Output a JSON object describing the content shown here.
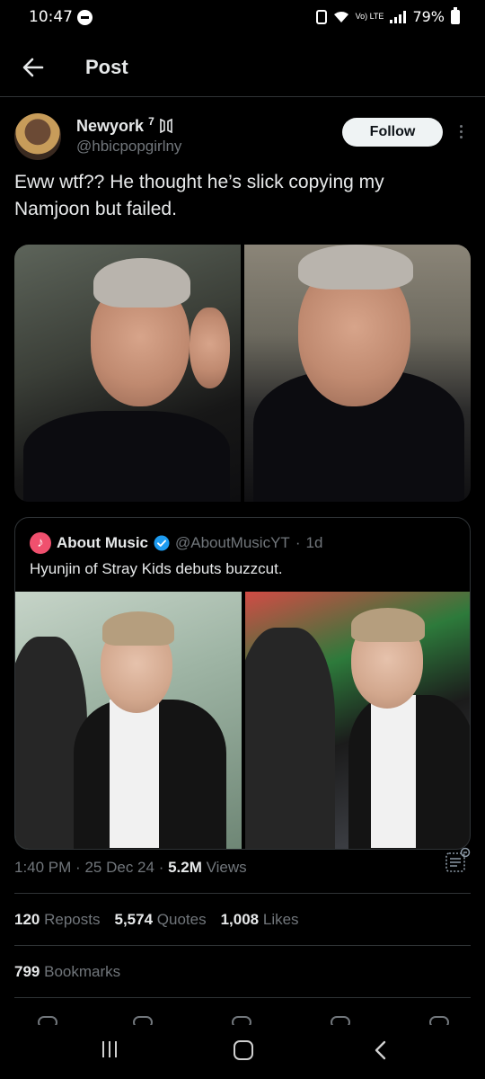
{
  "status_bar": {
    "time": "10:47",
    "lte_label": "Vo) LTE",
    "battery": "79%"
  },
  "header": {
    "title": "Post"
  },
  "author": {
    "name": "Newyork",
    "name_suffix": "7",
    "handle": "@hbicpopgirlny",
    "follow_label": "Follow"
  },
  "tweet": {
    "text": "Eww wtf?? He thought he’s slick copying my Namjoon but failed."
  },
  "quote": {
    "avatar_glyph": "♪",
    "name": "About Music",
    "handle": "@AboutMusicYT",
    "separator": "·",
    "age": "1d",
    "text": "Hyunjin of Stray Kids debuts buzzcut."
  },
  "meta": {
    "time": "1:40 PM",
    "separator": "·",
    "date": "25 Dec 24",
    "views_count": "5.2M",
    "views_label": "Views"
  },
  "stats": {
    "reposts_count": "120",
    "reposts_label": "Reposts",
    "quotes_count": "5,574",
    "quotes_label": "Quotes",
    "likes_count": "1,008",
    "likes_label": "Likes",
    "bookmarks_count": "799",
    "bookmarks_label": "Bookmarks"
  },
  "colors": {
    "background": "#000000",
    "text_primary": "#e7e9ea",
    "text_secondary": "#71767b",
    "border": "#2f3336",
    "verified": "#1d9bf0",
    "follow_bg": "#eff3f4"
  },
  "icons": {
    "back": "arrow-left-icon",
    "more": "more-vertical-icon",
    "verified": "verified-badge-icon",
    "analytics": "analytics-icon",
    "nav": [
      "recent-apps-icon",
      "home-icon",
      "back-chevron-icon"
    ]
  }
}
